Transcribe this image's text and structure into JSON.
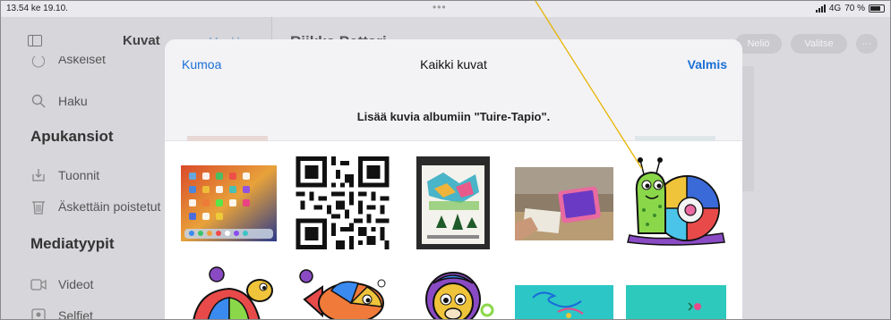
{
  "status_bar": {
    "time": "13.54",
    "date": "ke 19.10.",
    "network": "4G",
    "battery": "70 %"
  },
  "sidebar": {
    "title": "Kuvat",
    "edit_label": "Muokkaa",
    "partial_item": "Äskeiset",
    "search_item": "Haku",
    "section_utilities": "Apukansiot",
    "imports_item": "Tuonnit",
    "recently_deleted_item": "Äskettäin poistetut",
    "section_media": "Mediatyypit",
    "videos_item": "Videot",
    "selfies_item": "Selfiet"
  },
  "main": {
    "title": "Riikka Pettari",
    "aspect_button": "Neliö",
    "select_button": "Valitse",
    "more_button": "···"
  },
  "modal": {
    "cancel": "Kumoa",
    "title": "Kaikki kuvat",
    "done": "Valmis",
    "prompt": "Lisää kuvia albumiin \"Tuire-Tapio\"."
  },
  "photos": [
    {
      "id": "ipad-home-screenshot"
    },
    {
      "id": "qr-code"
    },
    {
      "id": "coloring-page-photo"
    },
    {
      "id": "tablet-on-desk-photo"
    },
    {
      "id": "snail-drawing"
    },
    {
      "id": "turtle-drawing"
    },
    {
      "id": "fish-drawing"
    },
    {
      "id": "monkey-drawing"
    },
    {
      "id": "teal-drawing-1"
    },
    {
      "id": "teal-drawing-2"
    }
  ],
  "colors": {
    "accent": "#1a6fd6",
    "annotation_line": "#e8b400"
  }
}
